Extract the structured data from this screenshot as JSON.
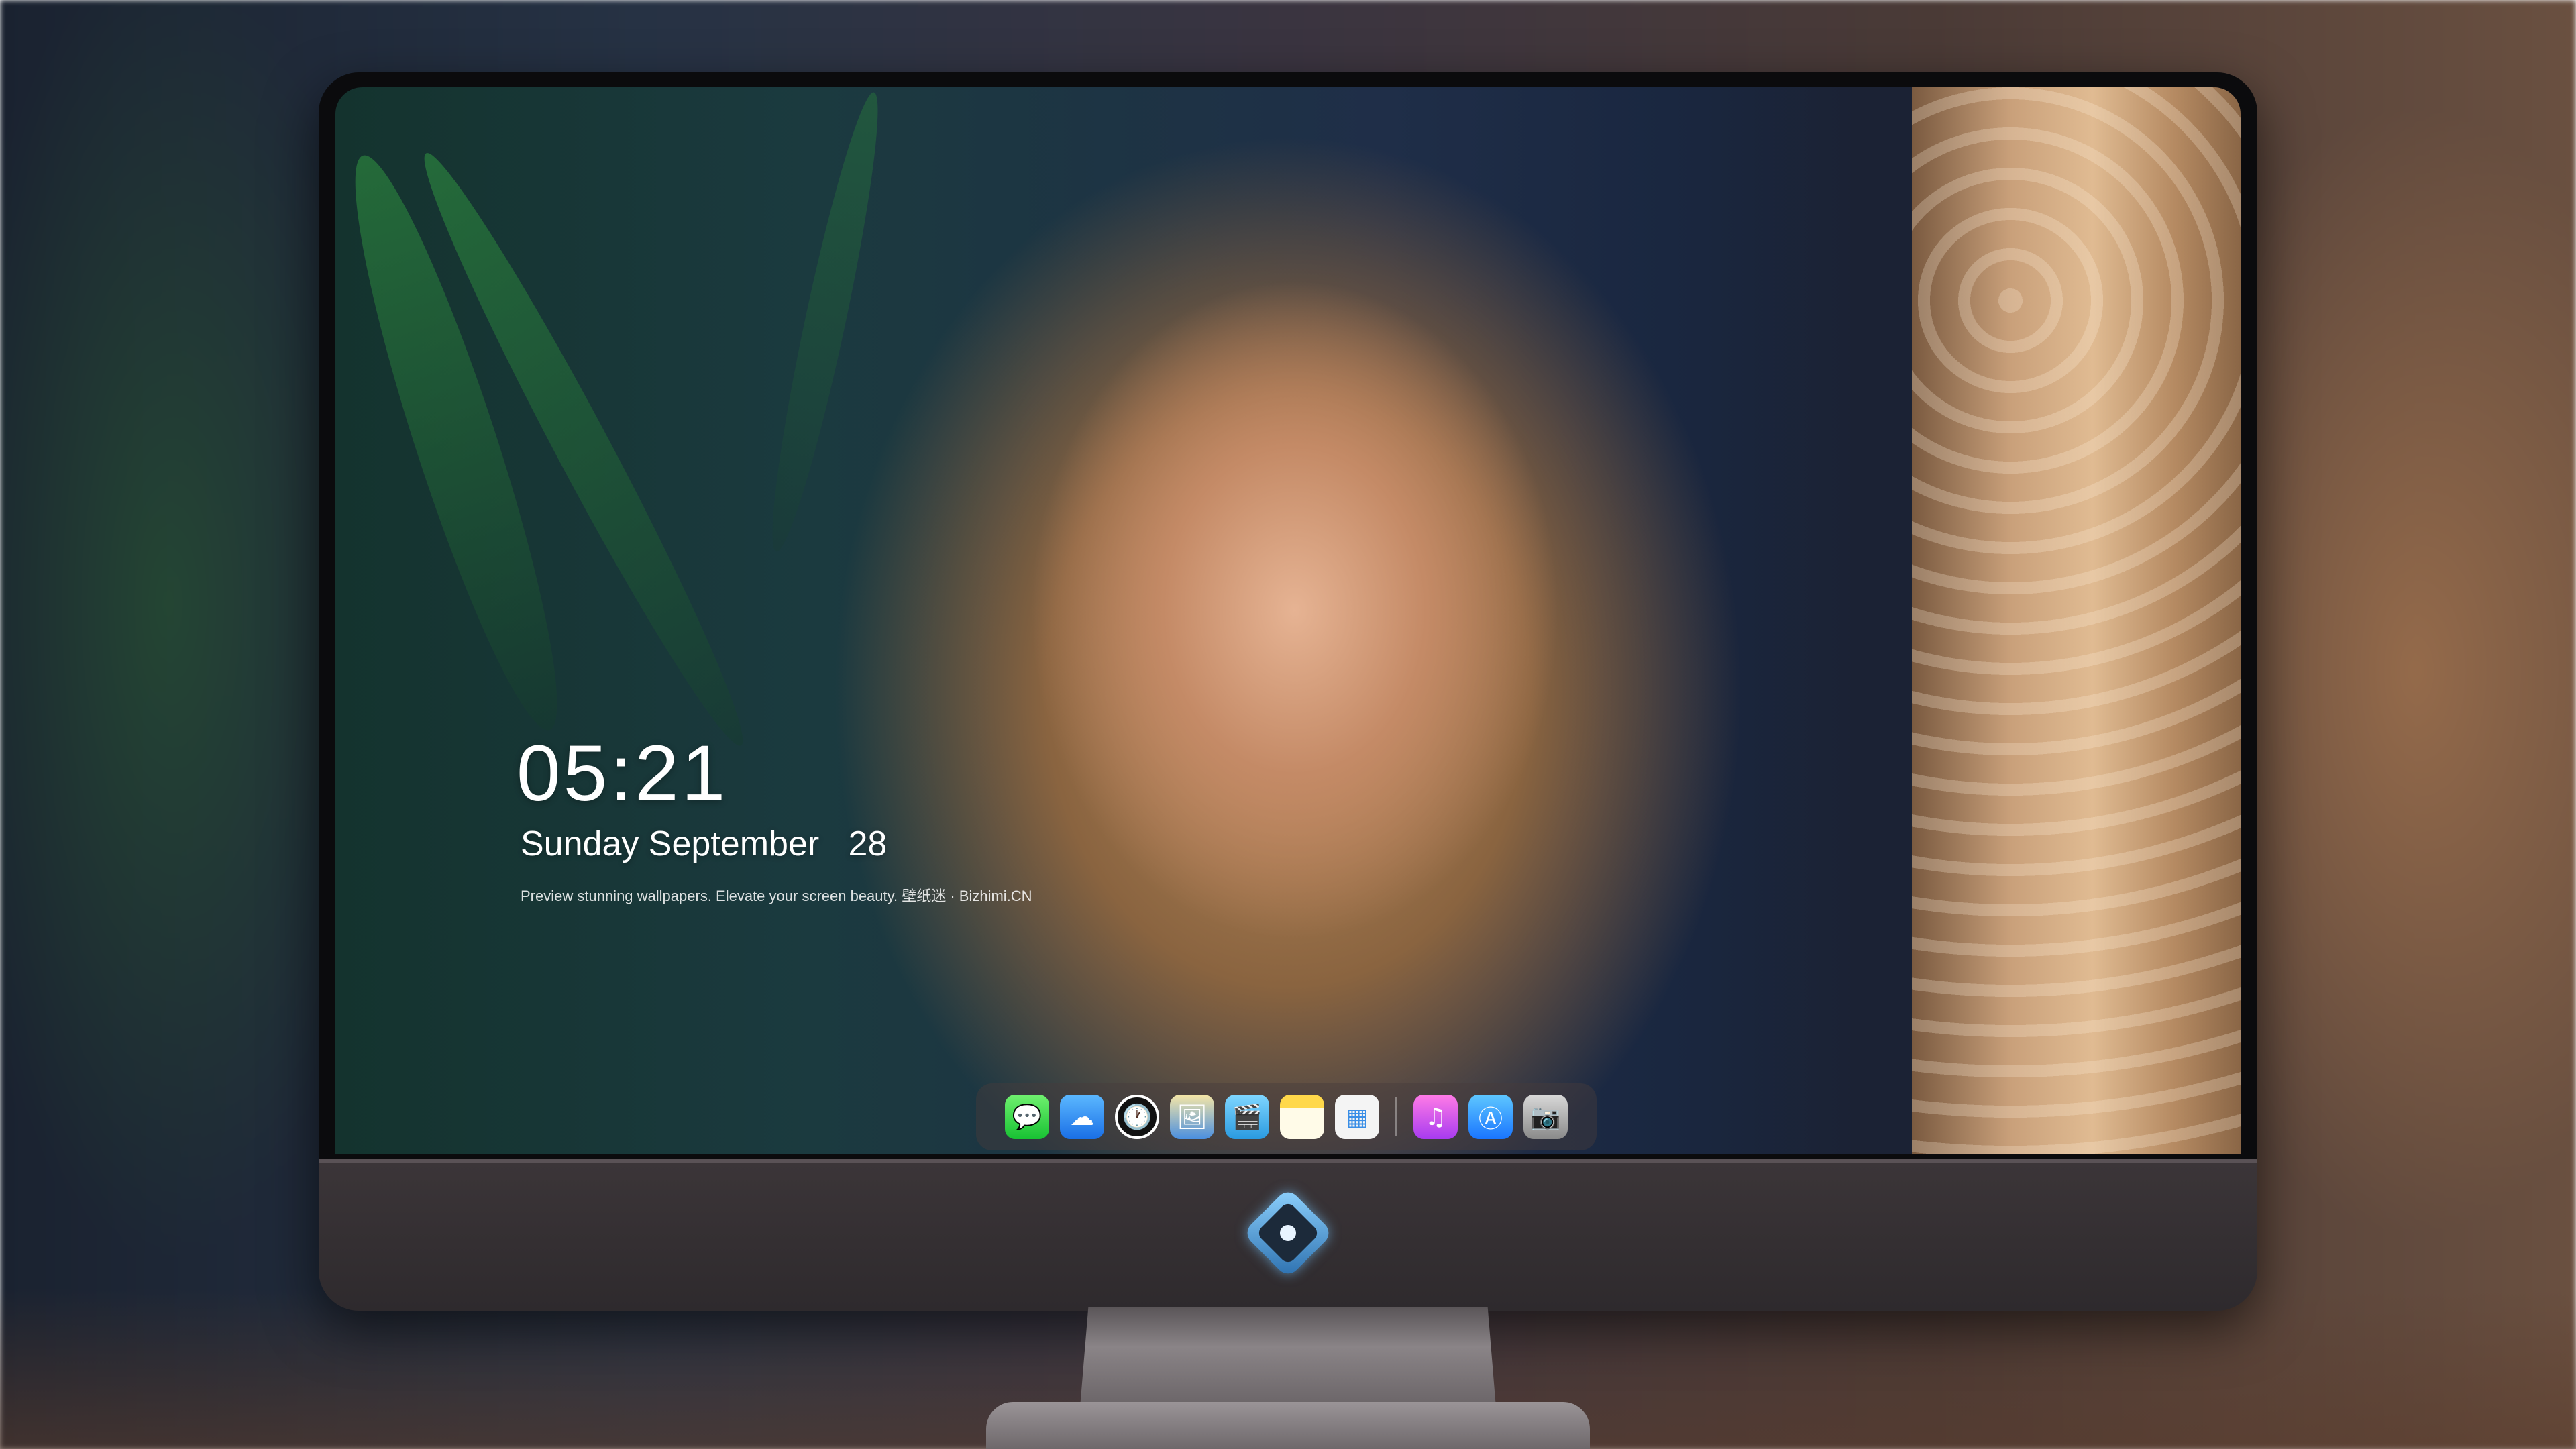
{
  "lockscreen": {
    "time": "05:21",
    "date": "Sunday September   28",
    "tagline": "Preview stunning wallpapers. Elevate your screen beauty. 壁纸迷 · Bizhimi.CN"
  },
  "dock": {
    "apps": [
      {
        "name": "messages-icon",
        "glyph": "💬"
      },
      {
        "name": "weather-icon",
        "glyph": "☁"
      },
      {
        "name": "clock-icon",
        "glyph": "🕐"
      },
      {
        "name": "preview-icon",
        "glyph": "🖼"
      },
      {
        "name": "clips-icon",
        "glyph": "🎬"
      },
      {
        "name": "notes-icon",
        "glyph": ""
      },
      {
        "name": "photos-icon",
        "glyph": "▦"
      },
      {
        "name": "music-icon",
        "glyph": "♫"
      },
      {
        "name": "app-store-icon",
        "glyph": "Ⓐ"
      },
      {
        "name": "camera-icon",
        "glyph": "📷"
      }
    ]
  },
  "colors": {
    "monitor_chin": "#3b3538",
    "dock_bg": "#463c3c"
  }
}
